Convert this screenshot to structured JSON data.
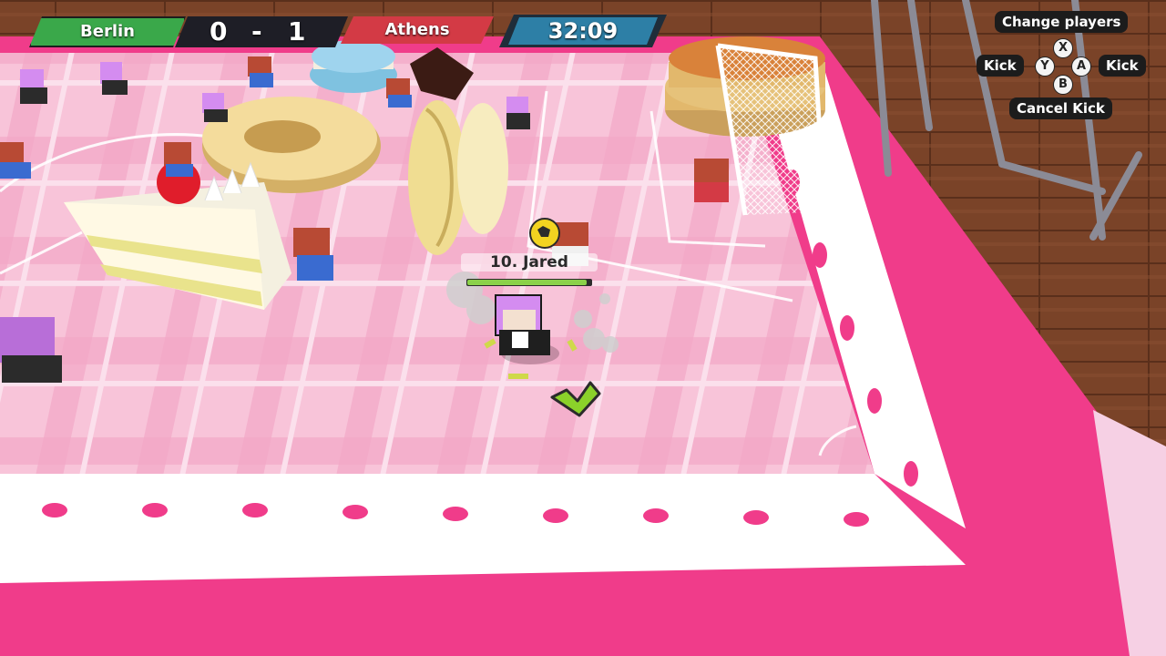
{
  "scoreboard": {
    "home_team": "Berlin",
    "home_score": "0",
    "separator": "-",
    "away_score": "1",
    "away_team": "Athens",
    "home_color": "#3aa84a",
    "away_color": "#d33a45"
  },
  "timer": {
    "time": "32:09"
  },
  "controls": {
    "change_players": "Change players",
    "button_x": "X",
    "button_y": "Y",
    "button_a": "A",
    "button_b": "B",
    "kick_left": "Kick",
    "kick_right": "Kick",
    "cancel_kick": "Cancel Kick"
  },
  "selected_player": {
    "label": "10. Jared",
    "stamina_fraction": 0.95
  },
  "icons": [
    "ball-icon",
    "direction-chevron-icon",
    "goal-net"
  ],
  "colors": {
    "tablecloth": "#f03c8a",
    "field": "#f7b8d2",
    "floor": "#6b3a22"
  }
}
